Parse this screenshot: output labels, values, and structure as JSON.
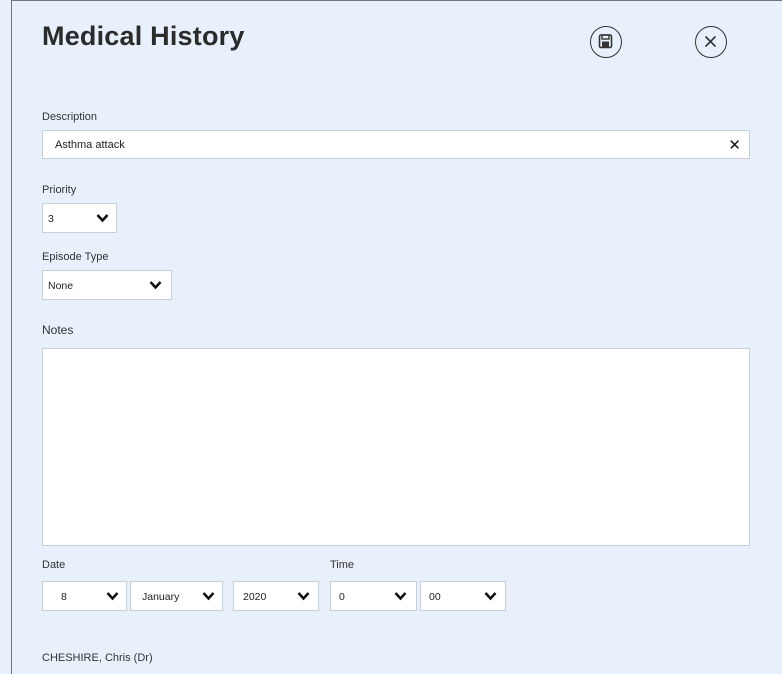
{
  "form": {
    "title": "Medical History",
    "description": {
      "label": "Description",
      "value": "Asthma attack",
      "clear_glyph": "✕"
    },
    "priority": {
      "label": "Priority",
      "value": "3"
    },
    "episode_type": {
      "label": "Episode Type",
      "value": "None"
    },
    "notes": {
      "label": "Notes",
      "value": ""
    },
    "date": {
      "label": "Date",
      "day": "8",
      "month": "January",
      "year": "2020"
    },
    "time": {
      "label": "Time",
      "hour": "0",
      "minute": "00"
    },
    "author": "CHESHIRE, Chris (Dr)"
  },
  "icons": {
    "save": "save-icon",
    "close": "close-circle-icon",
    "dropdown": "chevron-down-icon"
  }
}
